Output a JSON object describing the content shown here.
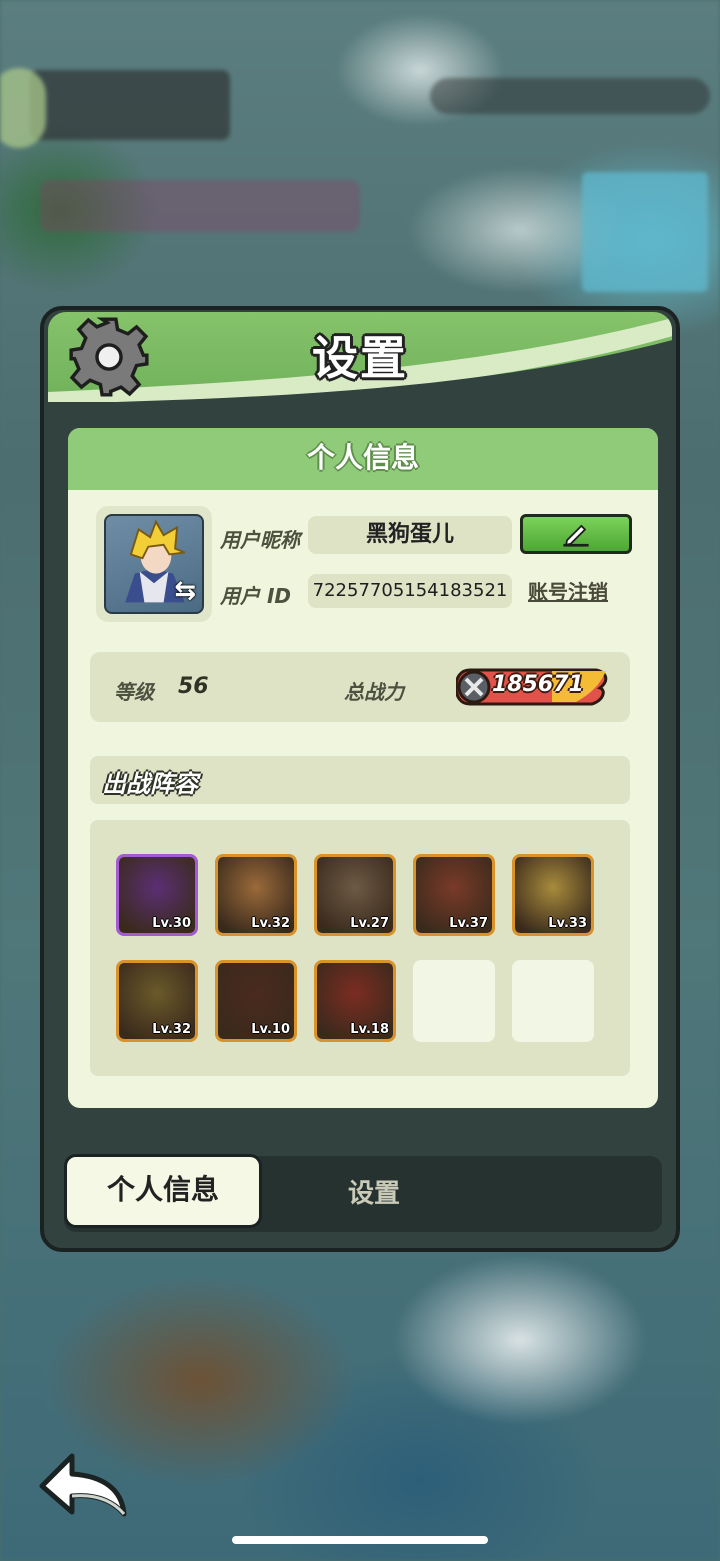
{
  "dialog": {
    "title": "设置",
    "panel_title": "个人信息"
  },
  "profile": {
    "nickname_label": "用户昵称",
    "nickname": "黑狗蛋儿",
    "id_label": "用户 ID",
    "user_id": "72257705154183521",
    "cancel_account": "账号注销"
  },
  "stats": {
    "level_label": "等级",
    "level": "56",
    "power_label": "总战力",
    "power": "185671"
  },
  "lineup": {
    "title": "出战阵容",
    "heroes": [
      {
        "level": "Lv.30",
        "frame": "purple",
        "art": "#5b2f74"
      },
      {
        "level": "Lv.32",
        "frame": "gold",
        "art": "#9a6a3a"
      },
      {
        "level": "Lv.27",
        "frame": "gold",
        "art": "#6d5a45"
      },
      {
        "level": "Lv.37",
        "frame": "gold",
        "art": "#7a3a28"
      },
      {
        "level": "Lv.33",
        "frame": "gold",
        "art": "#a88b3c"
      },
      {
        "level": "Lv.32",
        "frame": "gold",
        "art": "#6b5a2a"
      },
      {
        "level": "Lv.10",
        "frame": "gold",
        "art": "#4a2a1e"
      },
      {
        "level": "Lv.18",
        "frame": "gold",
        "art": "#7c2c22"
      }
    ],
    "empty_slots": 2
  },
  "tabs": {
    "active": "个人信息",
    "inactive": "设置"
  },
  "icons": {
    "gear": "gear-icon",
    "edit": "pencil-icon",
    "swap": "swap-arrows-icon",
    "back": "back-arrow-icon",
    "power": "crossed-swords-icon"
  },
  "colors": {
    "header_green": "#86c36b",
    "panel_bg": "#f0f6dd",
    "edit_button": "#5dbb3f"
  }
}
